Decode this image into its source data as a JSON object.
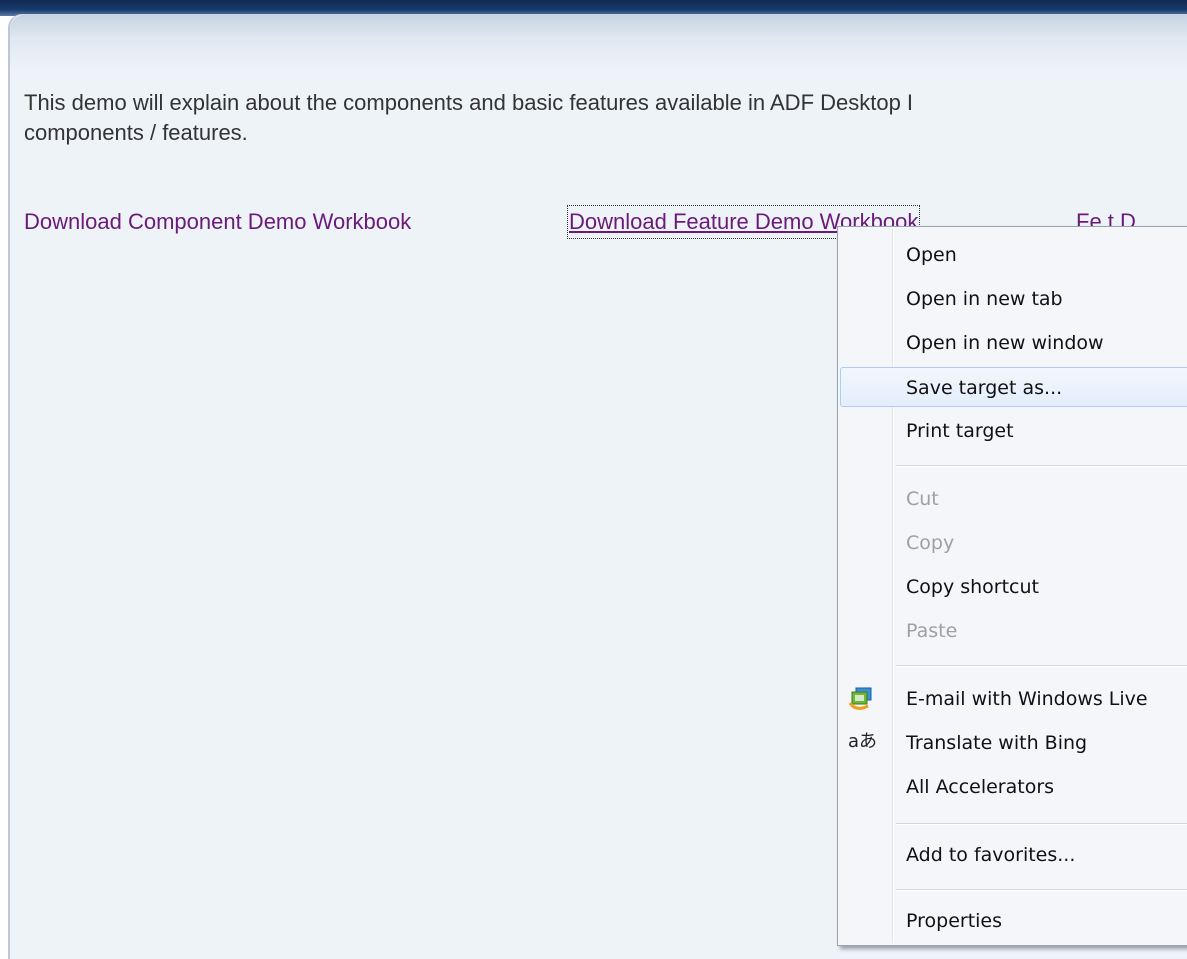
{
  "page": {
    "description": "This demo will explain about the components and basic features available in ADF Desktop I\ncomponents / features.",
    "links": {
      "component": "Download Component Demo Workbook",
      "feature": "Download Feature Demo Workbook",
      "extra": "Fe t  D"
    }
  },
  "context_menu": {
    "items": {
      "open": {
        "label": "Open",
        "enabled": true
      },
      "open_new_tab": {
        "label": "Open in new tab",
        "enabled": true
      },
      "open_new_window": {
        "label": "Open in new window",
        "enabled": true
      },
      "save_target": {
        "label": "Save target as...",
        "enabled": true,
        "highlighted": true
      },
      "print_target": {
        "label": "Print target",
        "enabled": true
      },
      "cut": {
        "label": "Cut",
        "enabled": false
      },
      "copy": {
        "label": "Copy",
        "enabled": false
      },
      "copy_shortcut": {
        "label": "Copy shortcut",
        "enabled": true
      },
      "paste": {
        "label": "Paste",
        "enabled": false
      },
      "email_live": {
        "label": "E-mail with Windows Live",
        "enabled": true,
        "icon": "windows-live-mail-icon"
      },
      "translate_bing": {
        "label": "Translate with Bing",
        "enabled": true,
        "icon": "translate-icon",
        "icon_glyph": "aあ"
      },
      "all_accelerators": {
        "label": "All Accelerators",
        "enabled": true
      },
      "add_favorites": {
        "label": "Add to favorites...",
        "enabled": true
      },
      "properties": {
        "label": "Properties",
        "enabled": true
      }
    }
  },
  "colors": {
    "link": "#6b1a7a",
    "panel_bg": "#eef3f8",
    "top_bar": "#0f2a52",
    "menu_bg": "#f4f6f9",
    "menu_highlight_border": "#aecdf1",
    "disabled_text": "#a0a0a0"
  }
}
